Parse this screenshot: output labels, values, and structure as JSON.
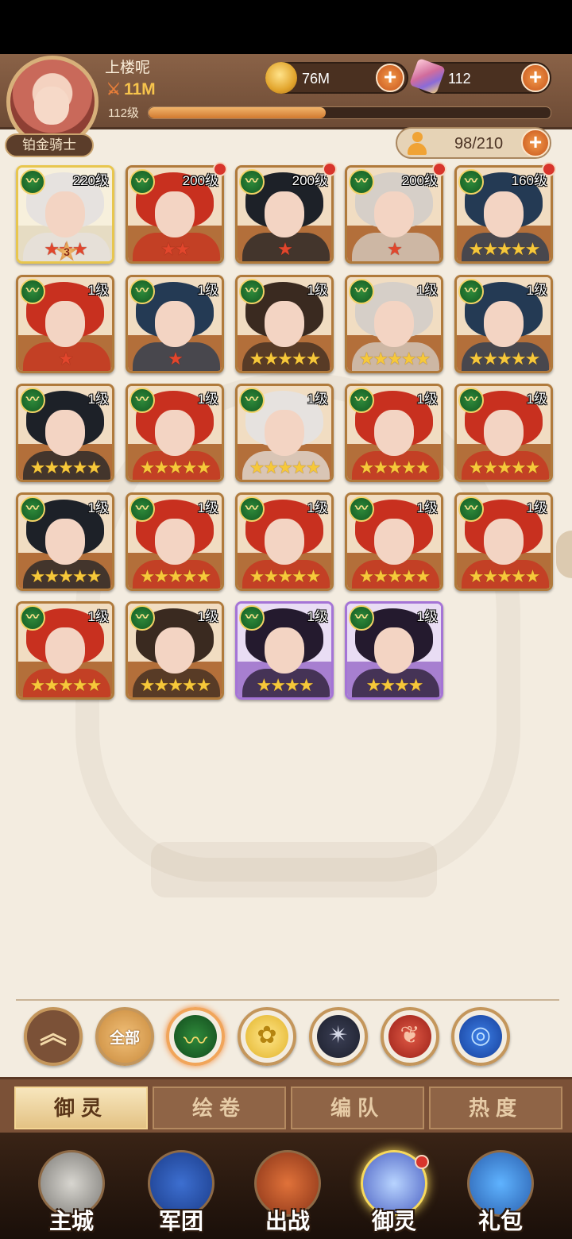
{
  "player": {
    "name": "上楼呢",
    "power": "11M",
    "rank": "铂金骑士",
    "level_label": "112级",
    "xp_fraction": 0.44
  },
  "resources": {
    "coins": "76M",
    "gems": "112"
  },
  "hero_count": "98/210",
  "colors": {
    "red_hair": "#c8301f",
    "black_hair": "#1d2128",
    "white_hair": "#e6e2df",
    "silver_hair": "#d6cfc8",
    "navy_hair": "#243a54",
    "brown_hair": "#3a2a20",
    "purple_hair": "#241a2e"
  },
  "heroes": [
    {
      "level": "220级",
      "stars": 3,
      "star_color": "red",
      "frame": "gold",
      "hair": "white_hair",
      "awaken": "3",
      "dot": false
    },
    {
      "level": "200级",
      "stars": 2,
      "star_color": "red",
      "frame": "bronze",
      "hair": "red_hair",
      "dot": true
    },
    {
      "level": "200级",
      "stars": 1,
      "star_color": "red",
      "frame": "bronze",
      "hair": "black_hair",
      "dot": true
    },
    {
      "level": "200级",
      "stars": 1,
      "star_color": "red",
      "frame": "bronze",
      "hair": "silver_hair",
      "dot": true
    },
    {
      "level": "160级",
      "stars": 5,
      "star_color": "gold",
      "frame": "bronze",
      "hair": "navy_hair",
      "dot": true
    },
    {
      "level": "1级",
      "stars": 1,
      "star_color": "red",
      "frame": "bronze",
      "hair": "red_hair",
      "dot": false
    },
    {
      "level": "1级",
      "stars": 1,
      "star_color": "red",
      "frame": "bronze",
      "hair": "navy_hair",
      "dot": false
    },
    {
      "level": "1级",
      "stars": 5,
      "star_color": "gold",
      "frame": "bronze",
      "hair": "brown_hair",
      "dot": false
    },
    {
      "level": "1级",
      "stars": 5,
      "star_color": "gold",
      "frame": "bronze",
      "hair": "silver_hair",
      "dot": false
    },
    {
      "level": "1级",
      "stars": 5,
      "star_color": "gold",
      "frame": "bronze",
      "hair": "navy_hair",
      "dot": false
    },
    {
      "level": "1级",
      "stars": 5,
      "star_color": "gold",
      "frame": "bronze",
      "hair": "black_hair",
      "dot": false
    },
    {
      "level": "1级",
      "stars": 5,
      "star_color": "gold",
      "frame": "bronze",
      "hair": "red_hair",
      "dot": false
    },
    {
      "level": "1级",
      "stars": 5,
      "star_color": "gold",
      "frame": "bronze",
      "hair": "white_hair",
      "dot": false
    },
    {
      "level": "1级",
      "stars": 5,
      "star_color": "gold",
      "frame": "bronze",
      "hair": "red_hair",
      "dot": false
    },
    {
      "level": "1级",
      "stars": 5,
      "star_color": "gold",
      "frame": "bronze",
      "hair": "red_hair",
      "dot": false
    },
    {
      "level": "1级",
      "stars": 5,
      "star_color": "gold",
      "frame": "bronze",
      "hair": "black_hair",
      "dot": false
    },
    {
      "level": "1级",
      "stars": 5,
      "star_color": "gold",
      "frame": "bronze",
      "hair": "red_hair",
      "dot": false
    },
    {
      "level": "1级",
      "stars": 5,
      "star_color": "gold",
      "frame": "bronze",
      "hair": "red_hair",
      "dot": false
    },
    {
      "level": "1级",
      "stars": 5,
      "star_color": "gold",
      "frame": "bronze",
      "hair": "red_hair",
      "dot": false
    },
    {
      "level": "1级",
      "stars": 5,
      "star_color": "gold",
      "frame": "bronze",
      "hair": "red_hair",
      "dot": false
    },
    {
      "level": "1级",
      "stars": 5,
      "star_color": "gold",
      "frame": "bronze",
      "hair": "red_hair",
      "dot": false
    },
    {
      "level": "1级",
      "stars": 5,
      "star_color": "gold",
      "frame": "bronze",
      "hair": "brown_hair",
      "dot": false
    },
    {
      "level": "1级",
      "stars": 4,
      "star_color": "gold",
      "frame": "purple",
      "hair": "purple_hair",
      "dot": false
    },
    {
      "level": "1级",
      "stars": 4,
      "star_color": "gold",
      "frame": "purple",
      "hair": "purple_hair",
      "dot": false
    }
  ],
  "filters": {
    "all_label": "全部",
    "items": [
      "collapse-icon",
      "all-factions",
      "nature-faction-icon",
      "rose-faction-icon",
      "star-faction-icon",
      "phoenix-faction-icon",
      "water-faction-icon"
    ]
  },
  "tabs": [
    "御灵",
    "绘卷",
    "编队",
    "热度"
  ],
  "nav": [
    "主城",
    "军团",
    "出战",
    "御灵",
    "礼包"
  ]
}
